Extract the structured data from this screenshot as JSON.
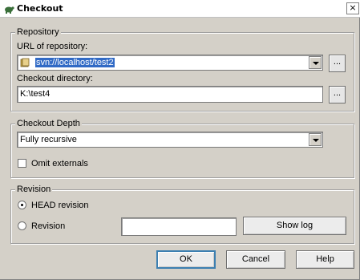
{
  "window": {
    "title": "Checkout",
    "close_glyph": "×"
  },
  "repository": {
    "legend": "Repository",
    "url_label": "URL of repository:",
    "url_value": "svn://localhost/test2",
    "browse_label": "...",
    "dir_label": "Checkout directory:",
    "dir_value": "K:\\test4",
    "dir_browse_label": "..."
  },
  "depth": {
    "legend": "Checkout Depth",
    "selected": "Fully recursive",
    "omit_externals_label": "Omit externals",
    "omit_externals_checked": false
  },
  "revision": {
    "legend": "Revision",
    "head_label": "HEAD revision",
    "head_selected": true,
    "revision_label": "Revision",
    "revision_value": "",
    "show_log_label": "Show log"
  },
  "buttons": {
    "ok": "OK",
    "cancel": "Cancel",
    "help": "Help"
  },
  "icons": {
    "app": "tortoise-icon",
    "folder": "folder-icon"
  },
  "colors": {
    "selection": "#316ac5",
    "dialog_bg": "#d4d0c8",
    "default_button_border": "#3c7fb1"
  }
}
